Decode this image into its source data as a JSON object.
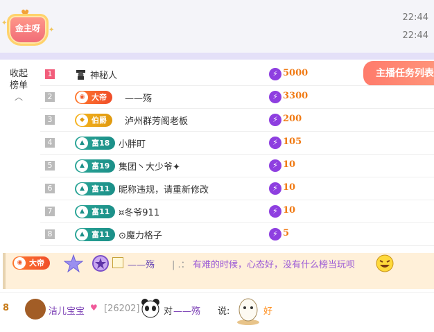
{
  "header": {
    "badge_label": "金主呀",
    "times": [
      "22:44",
      "22:44"
    ]
  },
  "sidebar": {
    "collapse_label_1": "收起",
    "collapse_label_2": "榜单"
  },
  "task_button": "主播任务列表",
  "ranking": [
    {
      "rank": "1",
      "tag": "",
      "tag_type": "",
      "name": "神秘人",
      "score": "5000"
    },
    {
      "rank": "2",
      "tag": "大帝",
      "tag_type": "dadi",
      "name": "——殇",
      "score": "3300"
    },
    {
      "rank": "3",
      "tag": "伯爵",
      "tag_type": "bojue",
      "name": "泸州群芳阁老板",
      "score": "200"
    },
    {
      "rank": "4",
      "tag": "富18",
      "tag_type": "fu",
      "name": "小胖町",
      "score": "105"
    },
    {
      "rank": "5",
      "tag": "富19",
      "tag_type": "fu",
      "name": "集团丶大少爷✦",
      "score": "10"
    },
    {
      "rank": "6",
      "tag": "富11",
      "tag_type": "fu",
      "name": "昵称违规，请重新修改",
      "score": "10"
    },
    {
      "rank": "7",
      "tag": "富11",
      "tag_type": "fu",
      "name": "¤冬爷911",
      "score": "10"
    },
    {
      "rank": "8",
      "tag": "富11",
      "tag_type": "fu",
      "name": "⊙魔力格子",
      "score": "5"
    }
  ],
  "chat_message": {
    "tag": "大帝",
    "username": "——殇",
    "separator": "| .：",
    "text": "有难的时候，心态好，没有什么榜当玩呗"
  },
  "gift_message": {
    "level": "8",
    "username": "洁儿宝宝",
    "uid": "[26202]",
    "dui": "对",
    "target": "——殇",
    "say": "说:",
    "gift_name": "好"
  },
  "colors": {
    "accent_orange": "#f07a14",
    "bolt_purple": "#8e3fe0",
    "rank_first": "#f25d7b",
    "chat_bg": "#fff0d9",
    "task_button": "#ff7b6b"
  }
}
